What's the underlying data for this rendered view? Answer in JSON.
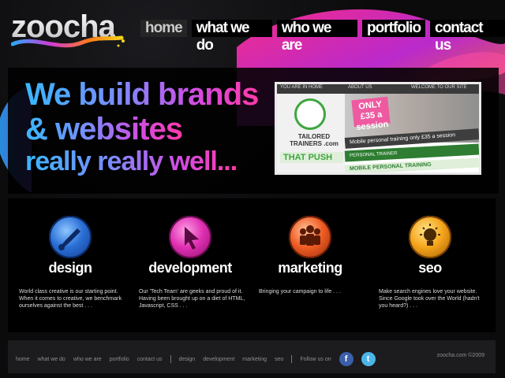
{
  "brand": {
    "name": "zoocha"
  },
  "nav": {
    "items": [
      "home",
      "what we do",
      "who we are",
      "portfolio",
      "contact us"
    ],
    "active": "home"
  },
  "hero": {
    "line1": "We build brands",
    "line2": "& websites",
    "line3": "really really well...",
    "screenshot": {
      "bar_left": "YOU ARE IN HOME",
      "bar_mid": "ABOUT US",
      "bar_right": "WELCOME TO OUR SITE",
      "price": "ONLY £35 a session",
      "logo_text": "TAILORED TRAINERS .com",
      "push": "THAT PUSH",
      "mid": "Mobile personal training only £35 a session",
      "green": "PERSONAL TRAINER",
      "green2": "MOBILE PERSONAL TRAINING"
    }
  },
  "services": [
    {
      "title": "design",
      "icon": "brush-icon",
      "text": "World class creative is our starting point. When it comes to creative, we benchmark ourselves against the best . . ."
    },
    {
      "title": "development",
      "icon": "cursor-icon",
      "text": "Our 'Tech Team' are geeks and proud of it. Having been brought up on a diet of HTML, Javascript, CSS . . ."
    },
    {
      "title": "marketing",
      "icon": "people-icon",
      "text": "Bringing your campaign to life . . ."
    },
    {
      "title": "seo",
      "icon": "lightbulb-icon",
      "text": "Make search engines love your website. Since Google took over the World (hadn't you heard?) . . ."
    }
  ],
  "footer": {
    "links": [
      "home",
      "what we do",
      "who we are",
      "portfolio",
      "contact us"
    ],
    "services": [
      "design",
      "development",
      "marketing",
      "seo"
    ],
    "follow": "Follow us on",
    "facebook": "f",
    "twitter": "t",
    "copyright": "zoocha.com ©2009"
  },
  "colors": {
    "design": "#3aa0ff",
    "development": "#e53ab8",
    "marketing": "#f06a2a",
    "seo": "#f5b21b"
  }
}
